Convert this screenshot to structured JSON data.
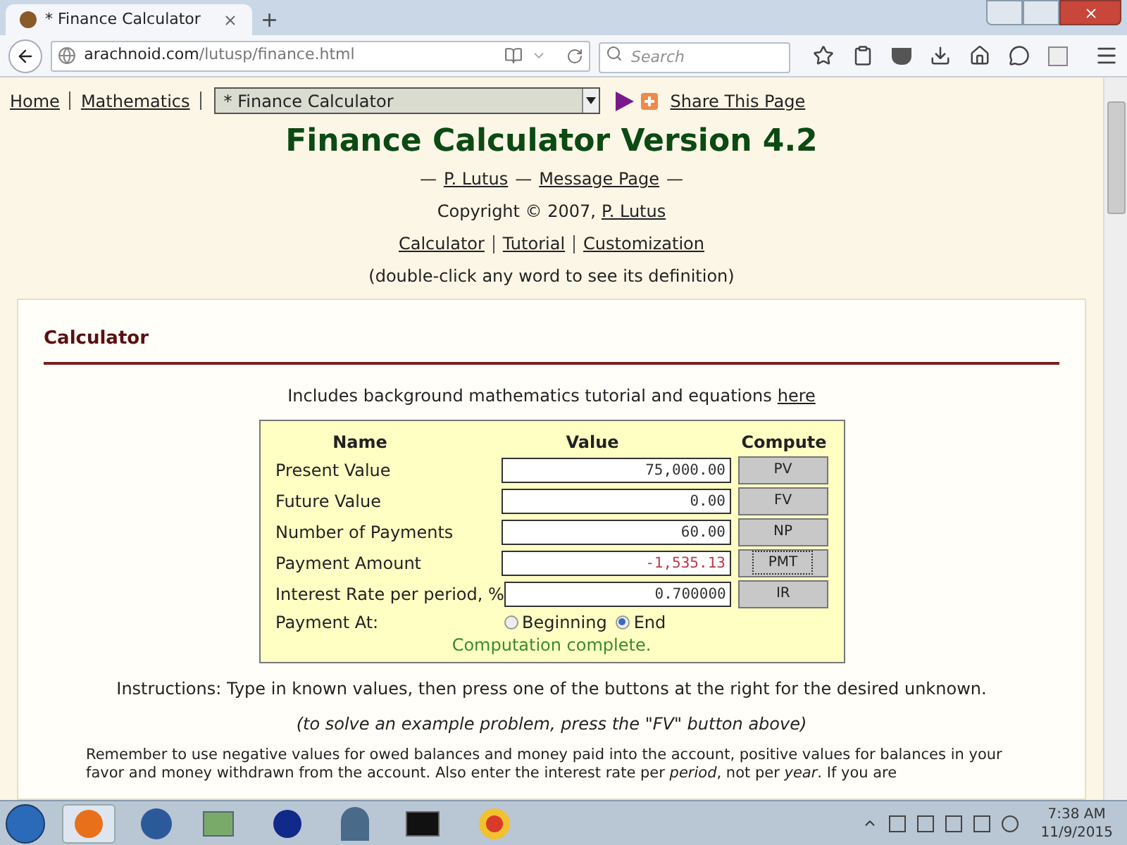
{
  "browser": {
    "tab_title": "* Finance Calculator",
    "new_tab": "+",
    "url_domain": "arachnoid.com",
    "url_path": "/lutusp/finance.html",
    "search_placeholder": "Search"
  },
  "nav": {
    "links": [
      "Home",
      "Mathematics"
    ],
    "page_select": "* Finance Calculator",
    "share": "Share This Page"
  },
  "title": "Finance Calculator Version 4.2",
  "byline": [
    {
      "kind": "text",
      "text": "—"
    },
    {
      "kind": "link",
      "text": "P. Lutus"
    },
    {
      "kind": "text",
      "text": "—"
    },
    {
      "kind": "link",
      "text": "Message Page"
    },
    {
      "kind": "text",
      "text": "—"
    }
  ],
  "copyright": [
    {
      "kind": "text",
      "text": "Copyright © 2007,"
    },
    {
      "kind": "link",
      "text": "P. Lutus"
    }
  ],
  "section_links": [
    "Calculator",
    "Tutorial",
    "Customization"
  ],
  "hint": "(double-click any word to see its definition)",
  "calculator": {
    "heading": "Calculator",
    "intro": [
      {
        "kind": "text",
        "text": "Includes background mathematics tutorial and equations"
      },
      {
        "kind": "link",
        "text": "here"
      }
    ],
    "columns": [
      "Name",
      "Value",
      "Compute"
    ],
    "rows": [
      {
        "name": "Present Value",
        "value": "75,000.00",
        "negative": false,
        "button": "PV",
        "focused": false
      },
      {
        "name": "Future Value",
        "value": "0.00",
        "negative": false,
        "button": "FV",
        "focused": false
      },
      {
        "name": "Number of Payments",
        "value": "60.00",
        "negative": false,
        "button": "NP",
        "focused": false
      },
      {
        "name": "Payment Amount",
        "value": "-1,535.13",
        "negative": true,
        "button": "PMT",
        "focused": true
      },
      {
        "name": "Interest Rate per period, %",
        "value": "0.700000",
        "negative": false,
        "button": "IR",
        "focused": false
      }
    ],
    "payment_at": {
      "label": "Payment At:",
      "options": [
        {
          "label": "Beginning",
          "selected": false
        },
        {
          "label": "End",
          "selected": true
        }
      ]
    },
    "status": "Computation complete.",
    "instructions": "Instructions: Type in known values, then press one of the buttons at the right for the desired unknown.",
    "example": "(to solve an example problem, press the \"FV\" button above)",
    "paragraph": "Remember to use negative values for owed balances and money paid into the account, positive values for balances in your favor and money withdrawn from the account. Also enter the interest rate per *period*, not per *year*. If you are"
  },
  "taskbar": {
    "time": "7:38 AM",
    "date": "11/9/2015"
  }
}
